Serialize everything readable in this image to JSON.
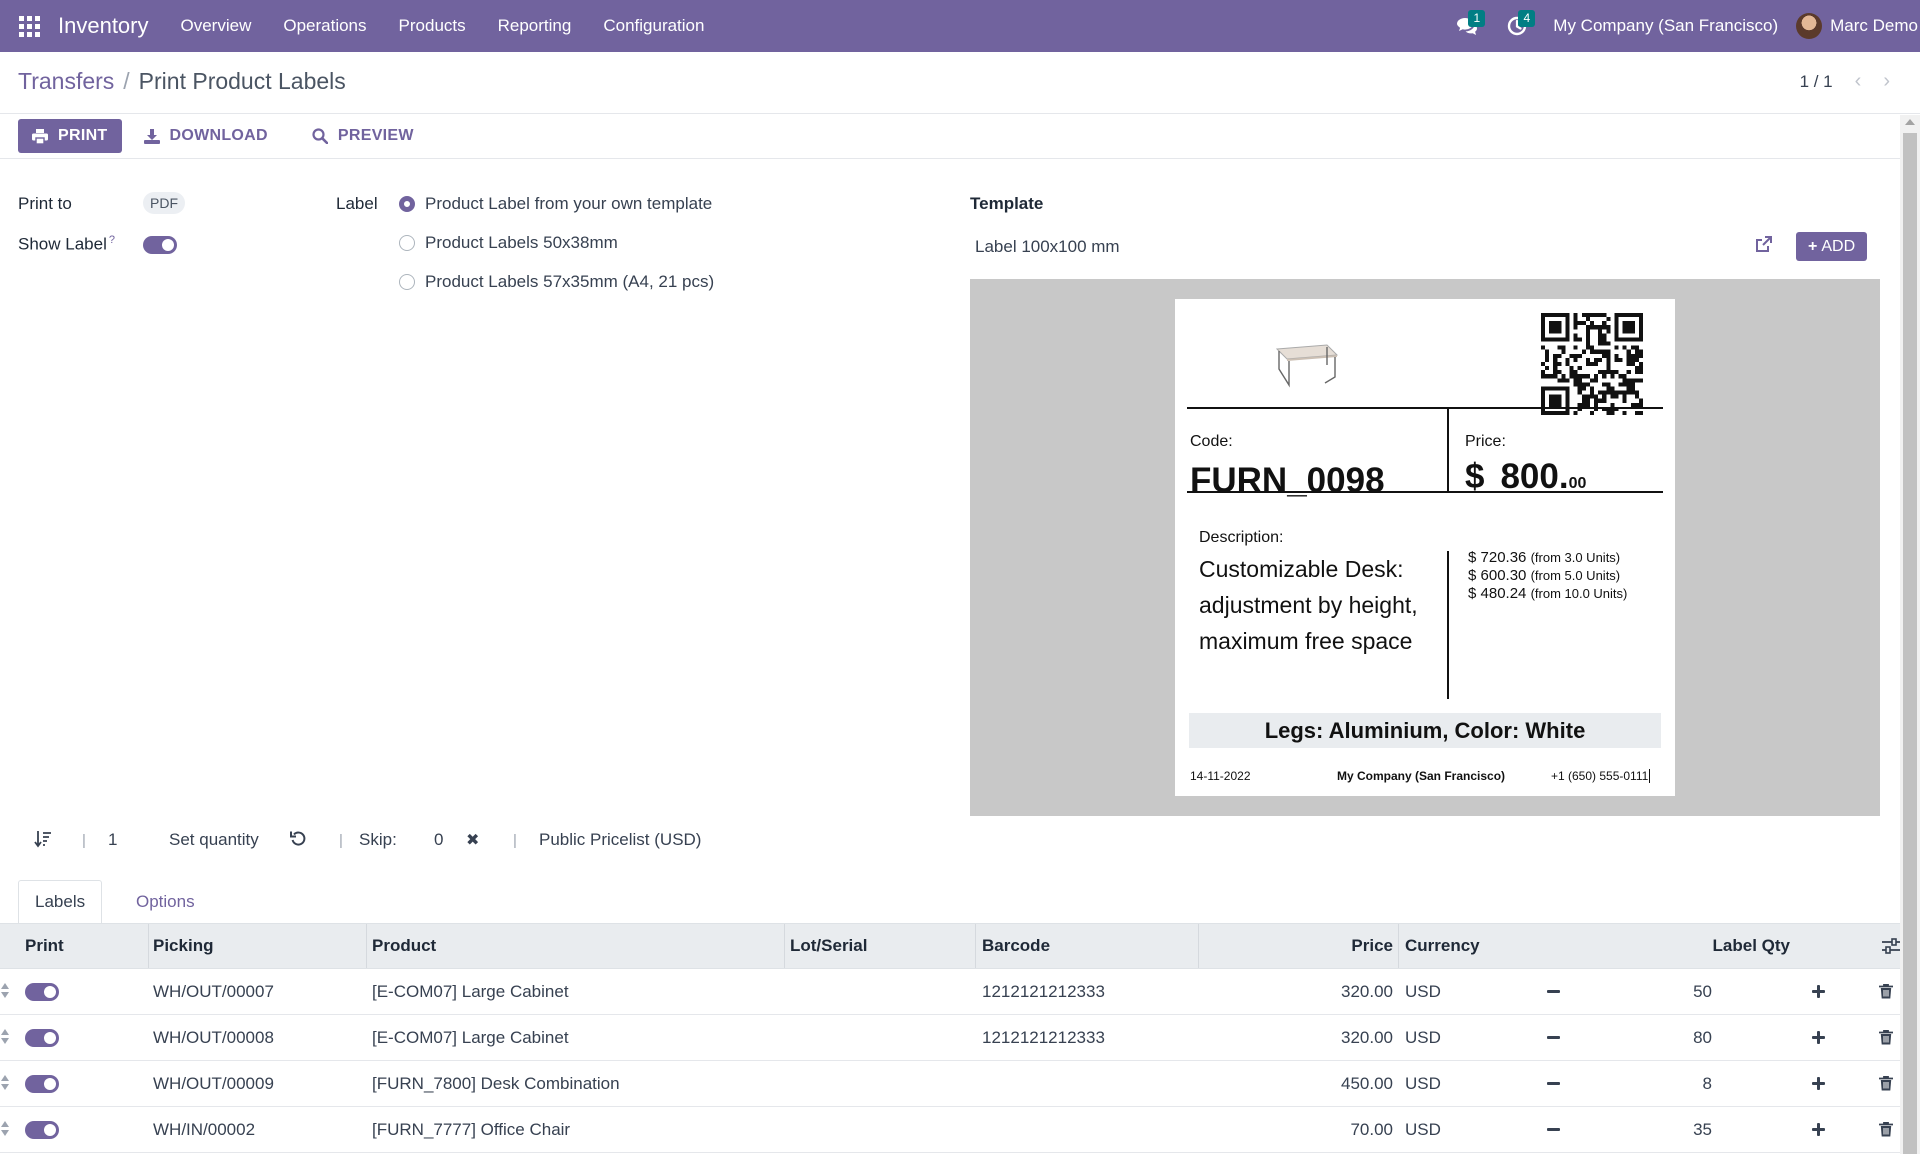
{
  "navbar": {
    "app_name": "Inventory",
    "menu": [
      "Overview",
      "Operations",
      "Products",
      "Reporting",
      "Configuration"
    ],
    "messages_count": "1",
    "activities_count": "4",
    "company": "My Company (San Francisco)",
    "user": "Marc Demo"
  },
  "breadcrumb": {
    "parent": "Transfers",
    "separator": "/",
    "current": "Print Product Labels"
  },
  "pager": {
    "value": "1 / 1"
  },
  "actions": {
    "print": "PRINT",
    "download": "DOWNLOAD",
    "preview": "PREVIEW"
  },
  "form": {
    "print_to_label": "Print to",
    "print_to_value": "PDF",
    "show_label_label": "Show Label",
    "show_label_help": "?",
    "show_label_on": true,
    "label_field_label": "Label",
    "label_options": [
      {
        "text": "Product Label from your own template",
        "selected": true
      },
      {
        "text": "Product Labels 50x38mm",
        "selected": false
      },
      {
        "text": "Product Labels 57x35mm (A4, 21 pcs)",
        "selected": false
      }
    ],
    "template_label": "Template",
    "template_value": "Label 100x100 mm",
    "add_button": "ADD"
  },
  "preview_label": {
    "code_caption": "Code:",
    "code": "FURN_0098",
    "price_caption": "Price:",
    "currency_symbol": "$",
    "price_main": "800.",
    "price_cents": "00",
    "description_caption": "Description:",
    "description": "Customizable Desk: adjustment by height, maximum free space",
    "tiers": [
      {
        "price": "$ 720.36",
        "note": "(from 3.0 Units)"
      },
      {
        "price": "$ 600.30",
        "note": "(from 5.0 Units)"
      },
      {
        "price": "$ 480.24",
        "note": "(from 10.0 Units)"
      }
    ],
    "attributes": "Legs: Aluminium, Color: White",
    "date": "14-11-2022",
    "company": "My Company (San Francisco)",
    "phone": "+1 (650) 555-0111"
  },
  "quantity_bar": {
    "quantity": "1",
    "set_quantity": "Set quantity",
    "skip_label": "Skip:",
    "skip_value": "0",
    "pricelist": "Public Pricelist (USD)"
  },
  "tabs": {
    "labels": "Labels",
    "options": "Options"
  },
  "table": {
    "headers": {
      "print": "Print",
      "picking": "Picking",
      "product": "Product",
      "lot": "Lot/Serial",
      "barcode": "Barcode",
      "price": "Price",
      "currency": "Currency",
      "label_qty": "Label Qty"
    },
    "rows": [
      {
        "picking": "WH/OUT/00007",
        "product": "[E-COM07] Large Cabinet",
        "lot": "",
        "barcode": "1212121212333",
        "price": "320.00",
        "currency": "USD",
        "qty": "50"
      },
      {
        "picking": "WH/OUT/00008",
        "product": "[E-COM07] Large Cabinet",
        "lot": "",
        "barcode": "1212121212333",
        "price": "320.00",
        "currency": "USD",
        "qty": "80"
      },
      {
        "picking": "WH/OUT/00009",
        "product": "[FURN_7800] Desk Combination",
        "lot": "",
        "barcode": "",
        "price": "450.00",
        "currency": "USD",
        "qty": "8"
      },
      {
        "picking": "WH/IN/00002",
        "product": "[FURN_7777] Office Chair",
        "lot": "",
        "barcode": "",
        "price": "70.00",
        "currency": "USD",
        "qty": "35"
      }
    ]
  },
  "colors": {
    "brand": "#71639e",
    "badge": "#017e84"
  },
  "icons": [
    "apps-grid-icon",
    "chat-icon",
    "clock-icon",
    "printer-icon",
    "download-icon",
    "search-icon",
    "external-link-icon",
    "plus-icon",
    "sort-icon",
    "undo-icon",
    "close-icon",
    "settings-sliders-icon",
    "drag-handle-icon",
    "minus-icon",
    "trash-icon"
  ]
}
